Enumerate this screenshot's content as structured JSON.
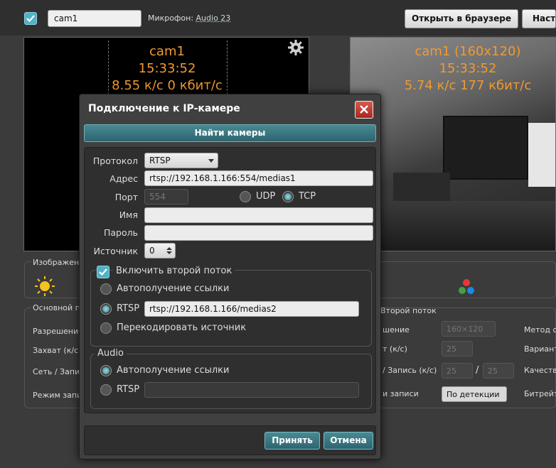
{
  "topbar": {
    "camera_name": "cam1",
    "mic_label": "Микрофон:",
    "mic_value": "Audio 23",
    "open_browser_label": "Открыть в браузере",
    "settings_label": "Настр"
  },
  "left_video": {
    "title": "cam1",
    "time": "15:33:52",
    "stats": "8.55 к/с 0 кбит/с"
  },
  "right_video": {
    "title": "cam1 (160x120)",
    "time": "15:33:52",
    "stats": "5.74 к/с 177 кбит/с"
  },
  "background": {
    "image_section": "Изображени",
    "main_stream": "Основной по",
    "rows_left": [
      "Разрешение",
      "Захват (к/с)",
      "Сеть / Запис",
      "Режим запис"
    ],
    "second_stream": "Второй поток",
    "rows_mid": [
      "шение",
      "т (к/с)",
      "/ Запись (к/с)",
      "и записи"
    ],
    "res_value": "160×120",
    "fps_value": "25",
    "net_value": "25",
    "rec_value": "25",
    "rec_sep": "/",
    "mode_value": "По детекции",
    "rows_right": [
      "Метод с",
      "Вариант",
      "Качеств",
      "Битрейт"
    ]
  },
  "dialog": {
    "title": "Подключение к IP-камере",
    "find_button": "Найти камеры",
    "protocol_label": "Протокол",
    "protocol_value": "RTSP",
    "address_label": "Адрес",
    "address_value": "rtsp://192.168.1.166:554/medias1",
    "port_label": "Порт",
    "port_value": "554",
    "udp_label": "UDP",
    "tcp_label": "TCP",
    "name_label": "Имя",
    "password_label": "Пароль",
    "source_label": "Источник",
    "source_value": "0",
    "second_stream": {
      "enable_label": "Включить второй поток",
      "auto_label": "Автополучение ссылки",
      "rtsp_label": "RTSP",
      "rtsp_value": "rtsp://192.168.1.166/medias2",
      "transcode_label": "Перекодировать источник"
    },
    "audio": {
      "legend": "Audio",
      "auto_label": "Автополучение ссылки",
      "rtsp_label": "RTSP"
    },
    "accept_button": "Принять",
    "cancel_button": "Отмена"
  },
  "colors": {
    "accent": "#4fb2c8",
    "overlay_text": "#f09a32",
    "close": "#c0392b"
  }
}
